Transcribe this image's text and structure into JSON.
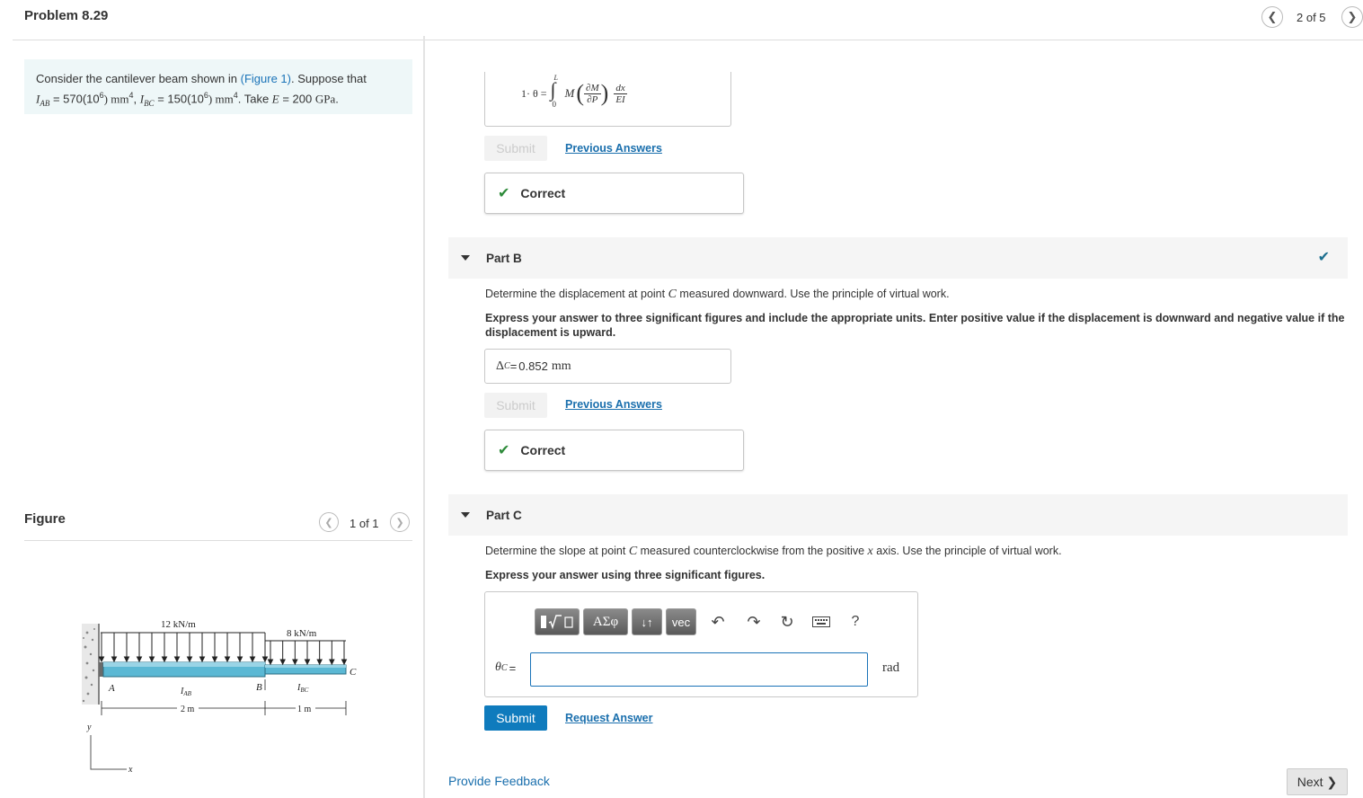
{
  "header": {
    "title": "Problem 8.29",
    "pager": "2 of 5"
  },
  "problem": {
    "intro": "Consider the cantilever beam shown in",
    "figure_link": "(Figure 1)",
    "suppose": ". Suppose that",
    "iab_label": "I",
    "iab_sub": "AB",
    "iab_val": " = 570(10",
    "iab_exp": "6",
    "iab_unit": ") mm",
    "iab_unit_exp": "4",
    "ibc_label": "I",
    "ibc_sub": "BC",
    "ibc_val": " = 150(10",
    "ibc_exp": "6",
    "ibc_unit": ") mm",
    "ibc_unit_exp": "4",
    "take": ". Take ",
    "e_label": "E",
    "e_val": " = 200 ",
    "e_unit": "GPa",
    "period": "."
  },
  "figure": {
    "title": "Figure",
    "pager": "1 of 1",
    "load1": "12 kN/m",
    "load2": "8 kN/m",
    "pt_a": "A",
    "pt_b": "B",
    "pt_c": "C",
    "i_ab": "I",
    "i_ab_sub": "AB",
    "i_bc": "I",
    "i_bc_sub": "BC",
    "dim1": "2 m",
    "dim2": "1 m",
    "axis_y": "y",
    "axis_x": "x"
  },
  "part_a": {
    "formula_lhs": "1· θ =",
    "formula_upper": "L",
    "formula_lower": "0",
    "formula_m": "M",
    "formula_num": "∂M",
    "formula_den": "∂P",
    "formula_dx": "dx",
    "formula_ei": "EI",
    "submit": "Submit",
    "previous": "Previous Answers",
    "correct": "Correct"
  },
  "part_b": {
    "title": "Part B",
    "question": "Determine the displacement at point",
    "question_pt": "C",
    "question_rest": " measured downward. Use the principle of virtual work.",
    "instructions": "Express your answer to three significant figures and include the appropriate units. Enter positive value if the displacement is downward and negative value if the displacement is upward.",
    "answer_label": "Δ",
    "answer_sub": "C",
    "answer_eq": " = ",
    "answer_value": "0.852",
    "answer_unit": "mm",
    "submit": "Submit",
    "previous": "Previous Answers",
    "correct": "Correct"
  },
  "part_c": {
    "title": "Part C",
    "question": "Determine the slope at point",
    "question_pt": "C",
    "question_mid": " measured counterclockwise from the positive ",
    "question_x": "x",
    "question_rest": " axis. Use the principle of virtual work.",
    "instructions": "Express your answer using three significant figures.",
    "toolbar_greek": "ΑΣφ",
    "toolbar_arrows": "↓↑",
    "toolbar_vec": "vec",
    "toolbar_help": "?",
    "answer_label": "θ",
    "answer_sub": "C",
    "answer_eq": " =",
    "answer_value": "",
    "answer_unit": "rad",
    "submit": "Submit",
    "request": "Request Answer"
  },
  "footer": {
    "feedback": "Provide Feedback",
    "next": "Next"
  },
  "colors": {
    "accent": "#0f7bbd",
    "correct": "#2e8b3a",
    "problem_bg": "#eef7f8",
    "beam": "#5bb8d4"
  }
}
